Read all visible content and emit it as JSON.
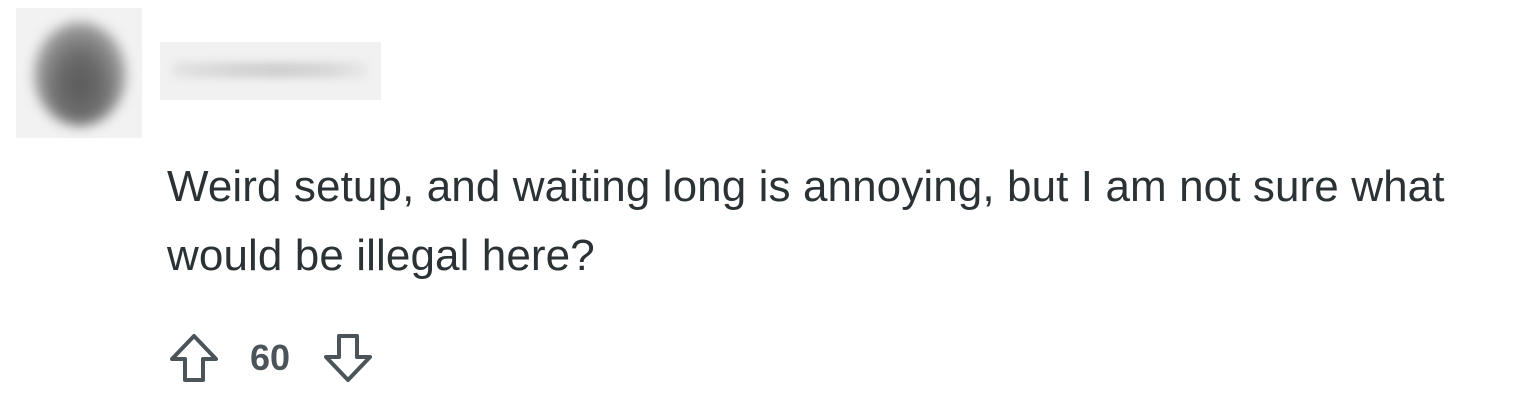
{
  "comment": {
    "author": {
      "username": "",
      "avatar_state": "blurred"
    },
    "body": "Weird setup, and waiting long is annoying, but I am not sure what would be illegal here?",
    "votes": {
      "score": "60",
      "upvote_icon": "arrow-up-outline-icon",
      "downvote_icon": "arrow-down-outline-icon"
    }
  },
  "colors": {
    "text": "#2b3236",
    "icon": "#4a5459",
    "background": "#ffffff"
  }
}
